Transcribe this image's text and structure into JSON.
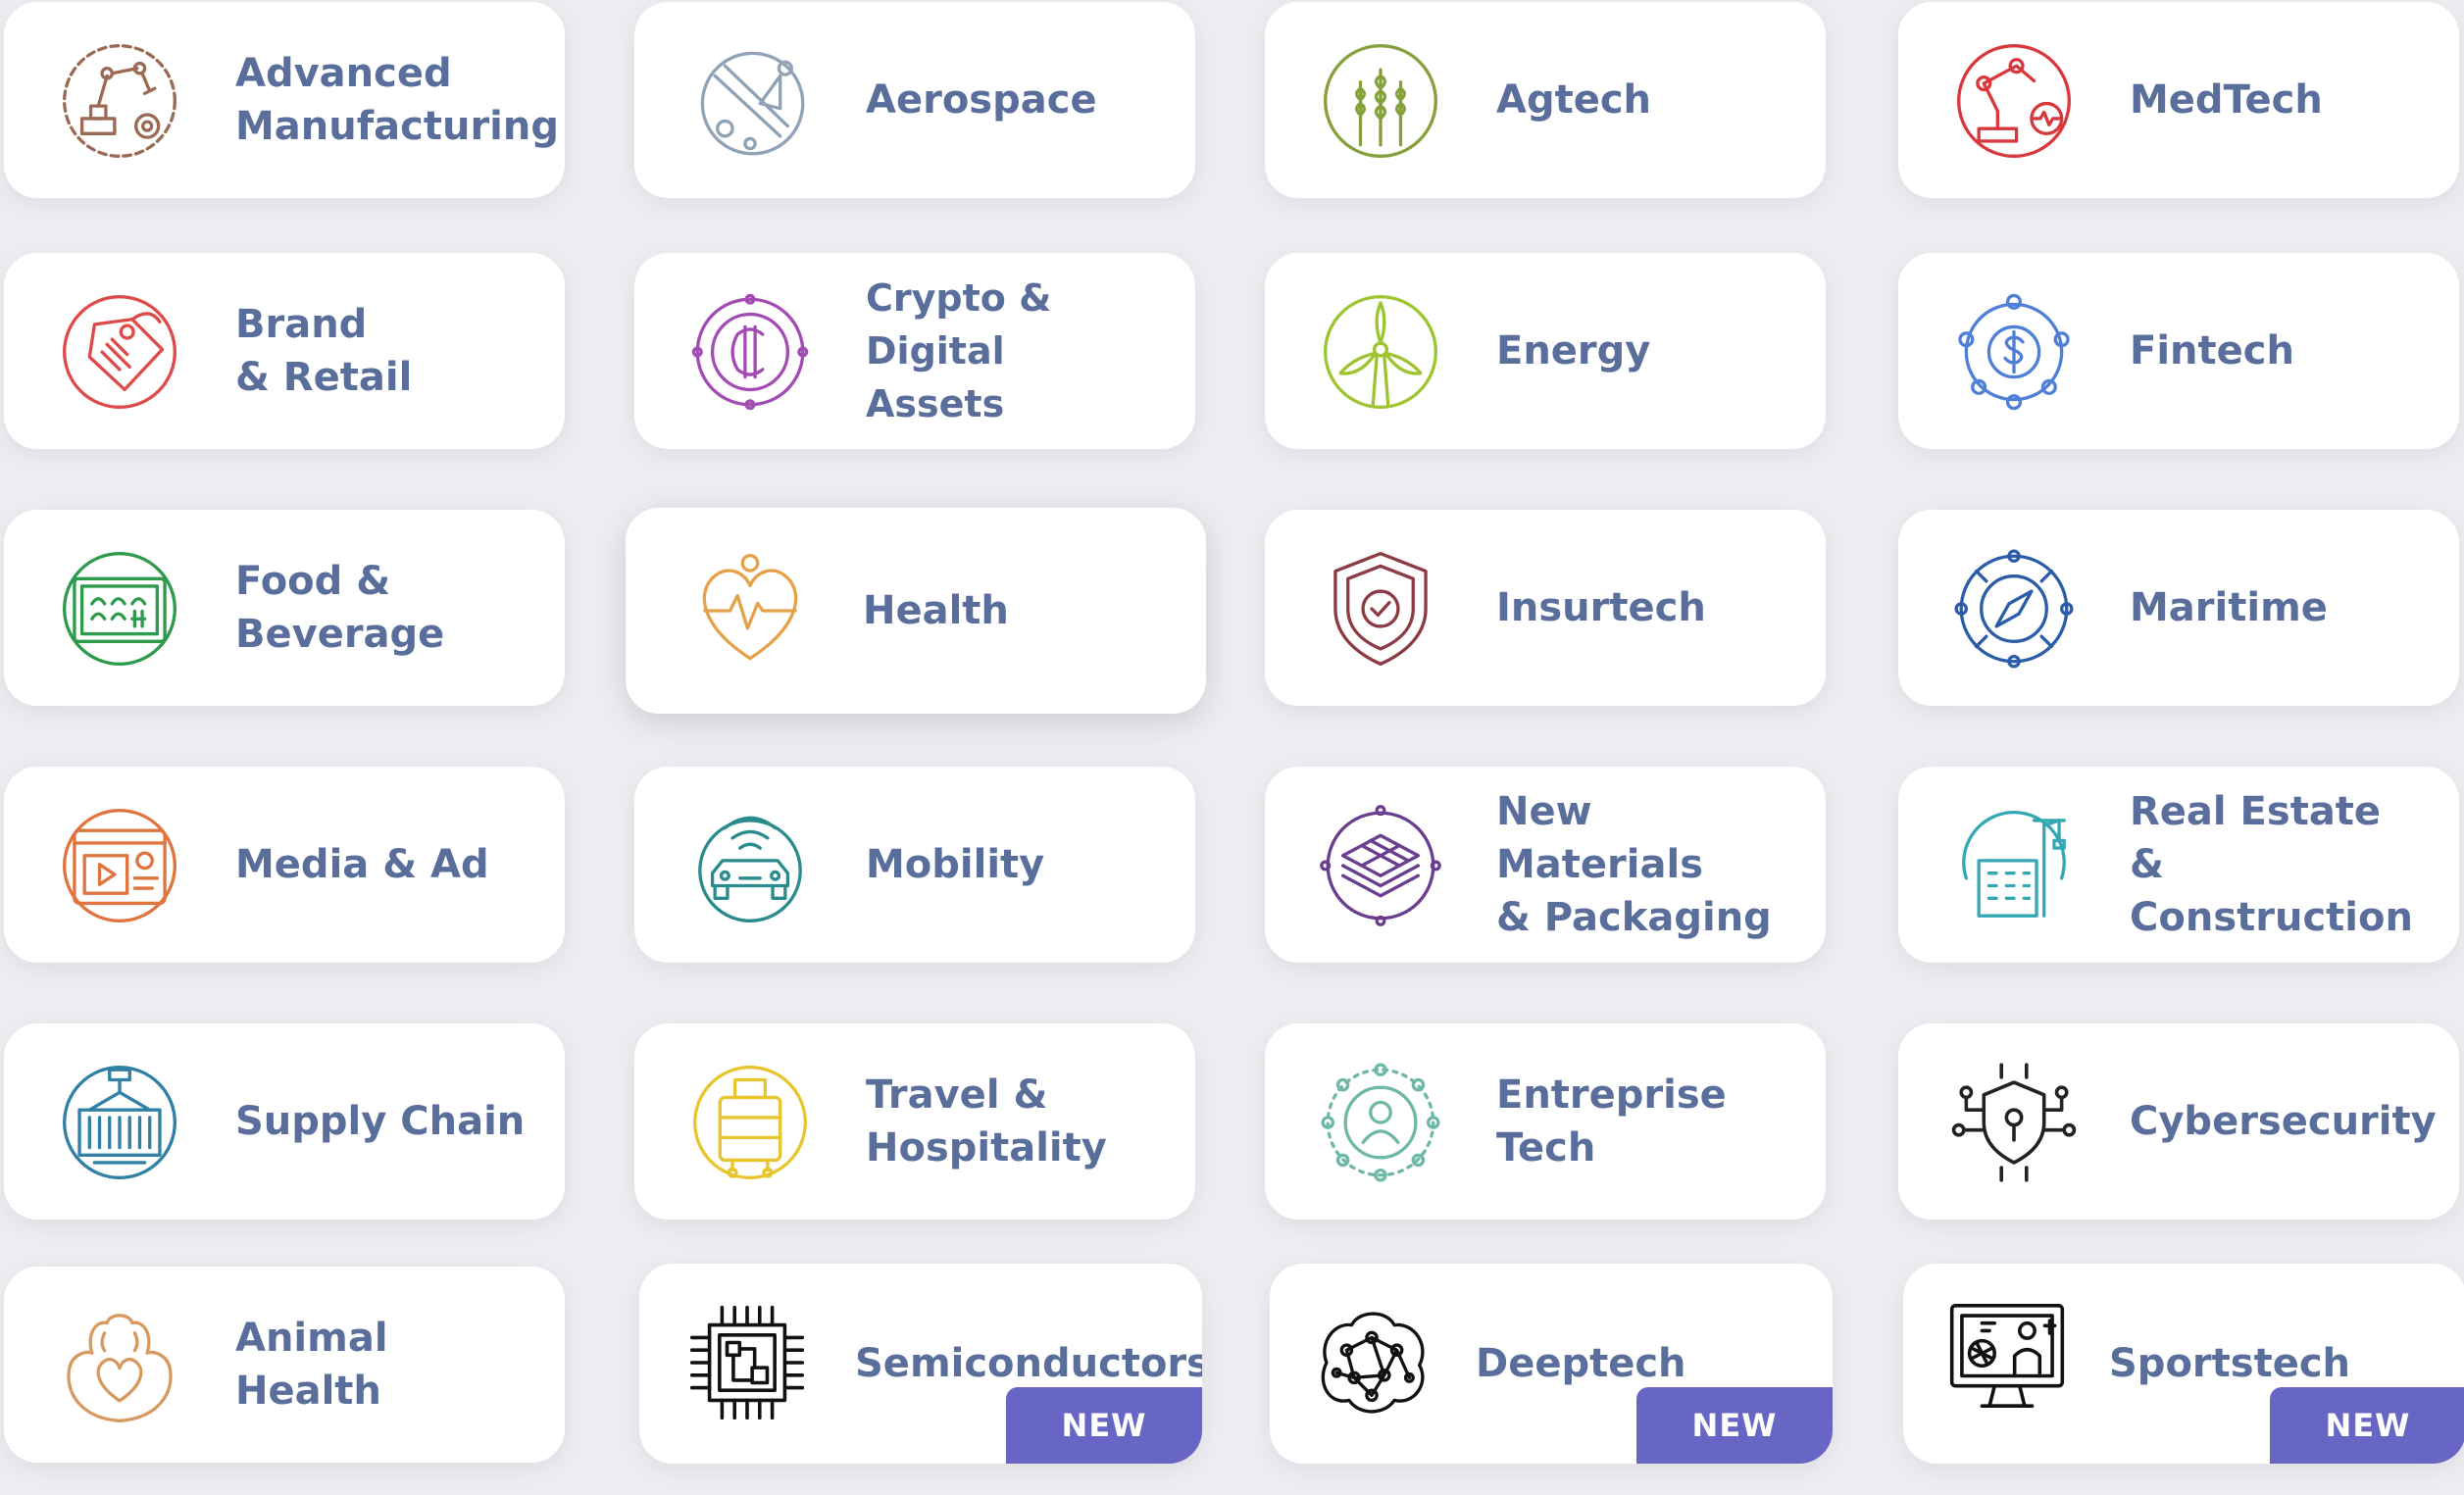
{
  "cards": [
    {
      "label": "Advanced\nManufacturing",
      "icon": "robot-arm-gear-icon",
      "color": "#9b6a55"
    },
    {
      "label": "Aerospace",
      "icon": "orbit-satellite-icon",
      "color": "#8fa2b6"
    },
    {
      "label": "Agtech",
      "icon": "wheat-icon",
      "color": "#86a03c"
    },
    {
      "label": "MedTech",
      "icon": "robot-arm-heartbeat-icon",
      "color": "#d8373c"
    },
    {
      "label": "Brand\n& Retail",
      "icon": "price-tag-icon",
      "color": "#dd4a4a"
    },
    {
      "label": "Crypto & Digital\nAssets",
      "icon": "crypto-coin-icon",
      "color": "#a24bb3"
    },
    {
      "label": "Energy",
      "icon": "wind-turbine-icon",
      "color": "#9ec531"
    },
    {
      "label": "Fintech",
      "icon": "dollar-network-icon",
      "color": "#4f7fd6"
    },
    {
      "label": "Food &\nBeverage",
      "icon": "food-crate-icon",
      "color": "#2e9a4c"
    },
    {
      "label": "Health",
      "icon": "heart-pulse-icon",
      "color": "#e5a24a"
    },
    {
      "label": "Insurtech",
      "icon": "shield-check-icon",
      "color": "#8c3b45"
    },
    {
      "label": "Maritime",
      "icon": "compass-icon",
      "color": "#2b5ca8"
    },
    {
      "label": "Media & Ad",
      "icon": "media-player-icon",
      "color": "#e0743f"
    },
    {
      "label": "Mobility",
      "icon": "connected-car-icon",
      "color": "#2a8b8d"
    },
    {
      "label": "New Materials\n& Packaging",
      "icon": "material-layers-icon",
      "color": "#6b3d8f"
    },
    {
      "label": "Real Estate\n& Construction",
      "icon": "crane-building-icon",
      "color": "#33a8b3"
    },
    {
      "label": "Supply Chain",
      "icon": "shipping-container-icon",
      "color": "#2f80a4"
    },
    {
      "label": "Travel &\nHospitality",
      "icon": "luggage-icon",
      "color": "#e8c52c"
    },
    {
      "label": "Entreprise\nTech",
      "icon": "user-network-icon",
      "color": "#6fb8a8"
    },
    {
      "label": "Cybersecurity",
      "icon": "shield-lock-circuit-icon",
      "color": "#222222"
    },
    {
      "label": "Animal Health",
      "icon": "paw-heart-icon",
      "color": "#d69a60"
    },
    {
      "label": "Semiconductors",
      "icon": "microchip-icon",
      "color": "#111111",
      "badge": "NEW"
    },
    {
      "label": "Deeptech",
      "icon": "neural-network-icon",
      "color": "#111111",
      "badge": "NEW"
    },
    {
      "label": "Sportstech",
      "icon": "sports-monitor-icon",
      "color": "#111111",
      "badge": "NEW"
    }
  ]
}
